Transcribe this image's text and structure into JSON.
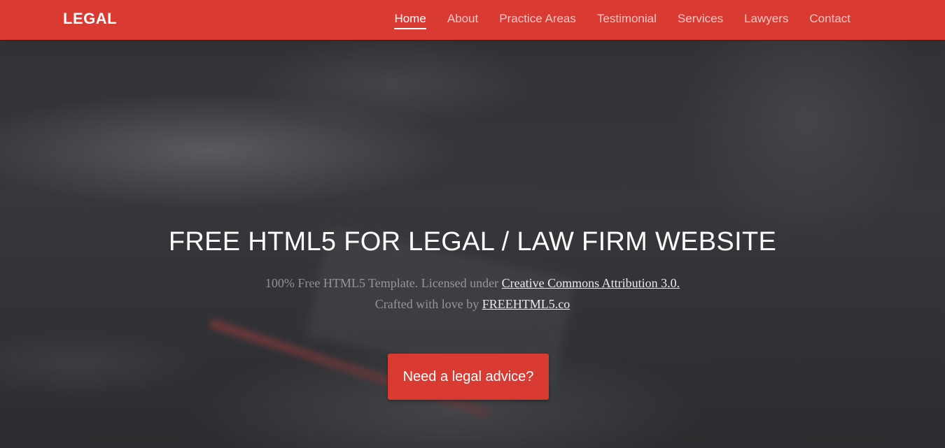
{
  "brand": "LEGAL",
  "nav": {
    "items": [
      {
        "label": "Home",
        "active": true
      },
      {
        "label": "About"
      },
      {
        "label": "Practice Areas"
      },
      {
        "label": "Testimonial"
      },
      {
        "label": "Services"
      },
      {
        "label": "Lawyers"
      },
      {
        "label": "Contact"
      }
    ]
  },
  "hero": {
    "title": "FREE HTML5 FOR LEGAL / LAW FIRM WEBSITE",
    "line1_prefix": "100% Free HTML5 Template. Licensed under ",
    "line1_link": "Creative Commons Attribution 3.0.",
    "line2_prefix": "Crafted with love by ",
    "line2_link": "FREEHTML5.co",
    "cta": "Need a legal advice?"
  },
  "colors": {
    "accent": "#d93a32",
    "hero_bg": "#303134",
    "text": "#ffffff"
  }
}
